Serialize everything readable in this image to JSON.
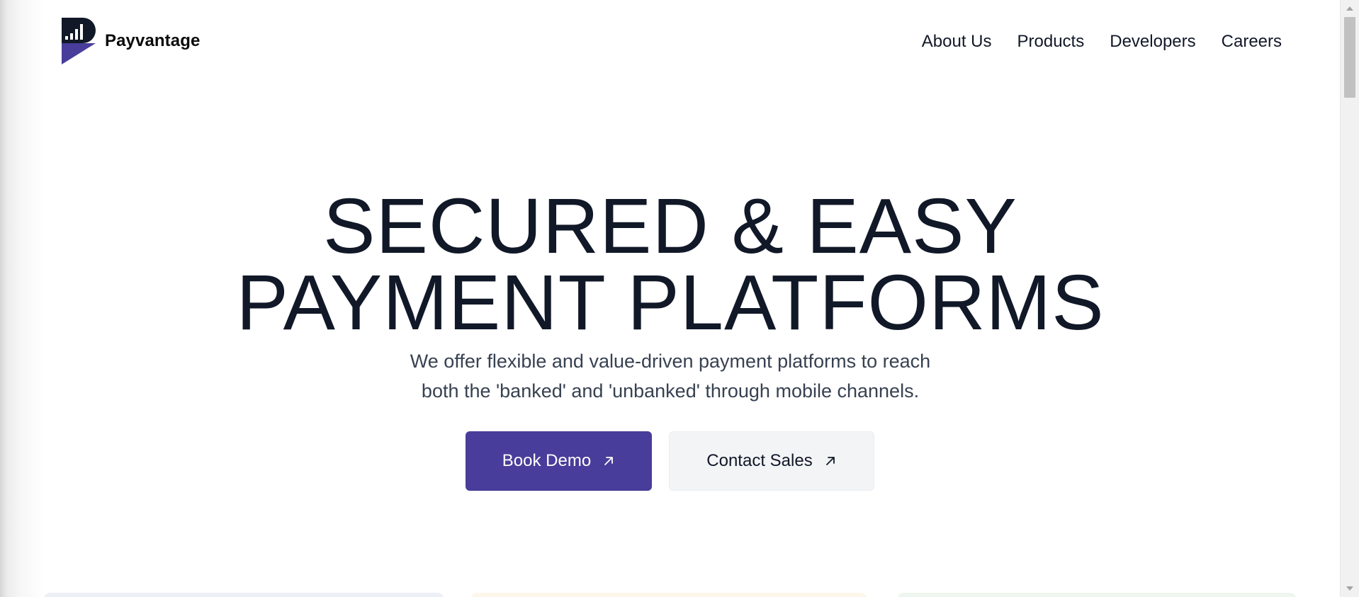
{
  "brand": {
    "name": "Payvantage",
    "logo_icon": "payvantage-logo-icon",
    "logo_colors": {
      "dark": "#111827",
      "accent": "#483d9a"
    }
  },
  "nav": {
    "items": [
      {
        "label": "About Us"
      },
      {
        "label": "Products"
      },
      {
        "label": "Developers"
      },
      {
        "label": "Careers"
      }
    ]
  },
  "hero": {
    "title_line_1": "SECURED & EASY",
    "title_line_2": "PAYMENT PLATFORMS",
    "subtitle_line_1": "We offer flexible and value-driven payment platforms to reach",
    "subtitle_line_2": "both the 'banked' and 'unbanked' through mobile channels."
  },
  "cta": {
    "primary_label": "Book Demo",
    "secondary_label": "Contact Sales",
    "icon": "arrow-up-right-icon"
  },
  "colors": {
    "primary": "#483d9a",
    "text": "#111827",
    "muted_text": "#374151",
    "secondary_bg": "#f3f4f6",
    "card_tints": [
      "#eef0f7",
      "#fdf6ea",
      "#eef6ef"
    ]
  }
}
